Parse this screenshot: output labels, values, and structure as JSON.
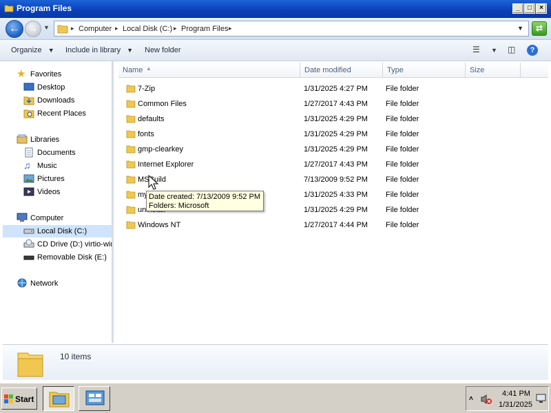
{
  "window": {
    "title": "Program Files"
  },
  "address": {
    "crumbs": [
      "Computer",
      "Local Disk (C:)",
      "Program Files"
    ]
  },
  "toolbar": {
    "organize": "Organize",
    "include": "Include in library",
    "new_folder": "New folder"
  },
  "nav": {
    "favorites": "Favorites",
    "desktop": "Desktop",
    "downloads": "Downloads",
    "recent": "Recent Places",
    "libraries": "Libraries",
    "documents": "Documents",
    "music": "Music",
    "pictures": "Pictures",
    "videos": "Videos",
    "computer": "Computer",
    "local_disk": "Local Disk (C:)",
    "cd_drive": "CD Drive (D:) virtio-win",
    "removable": "Removable Disk (E:)",
    "network": "Network"
  },
  "columns": {
    "name": "Name",
    "date": "Date modified",
    "type": "Type",
    "size": "Size"
  },
  "files": [
    {
      "name": "7-Zip",
      "date": "1/31/2025 4:27 PM",
      "type": "File folder"
    },
    {
      "name": "Common Files",
      "date": "1/27/2017 4:43 PM",
      "type": "File folder"
    },
    {
      "name": "defaults",
      "date": "1/31/2025 4:29 PM",
      "type": "File folder"
    },
    {
      "name": "fonts",
      "date": "1/31/2025 4:29 PM",
      "type": "File folder"
    },
    {
      "name": "gmp-clearkey",
      "date": "1/31/2025 4:29 PM",
      "type": "File folder"
    },
    {
      "name": "Internet Explorer",
      "date": "1/27/2017 4:43 PM",
      "type": "File folder"
    },
    {
      "name": "MSBuild",
      "date": "7/13/2009 9:52 PM",
      "type": "File folder"
    },
    {
      "name": "my",
      "date": "1/31/2025 4:33 PM",
      "type": "File folder"
    },
    {
      "name": "uninstall",
      "date": "1/31/2025 4:29 PM",
      "type": "File folder"
    },
    {
      "name": "Windows NT",
      "date": "1/27/2017 4:44 PM",
      "type": "File folder"
    }
  ],
  "tooltip": {
    "line1": "Date created: 7/13/2009 9:52 PM",
    "line2": "Folders: Microsoft"
  },
  "details": {
    "count": "10 items"
  },
  "taskbar": {
    "start": "Start",
    "time": "4:41 PM",
    "date": "1/31/2025"
  },
  "colors": {
    "title_bar": "#0a3fb8",
    "selection": "#cfe3fc",
    "tooltip_bg": "#ffffe1",
    "taskbar": "#d4d0c8"
  }
}
